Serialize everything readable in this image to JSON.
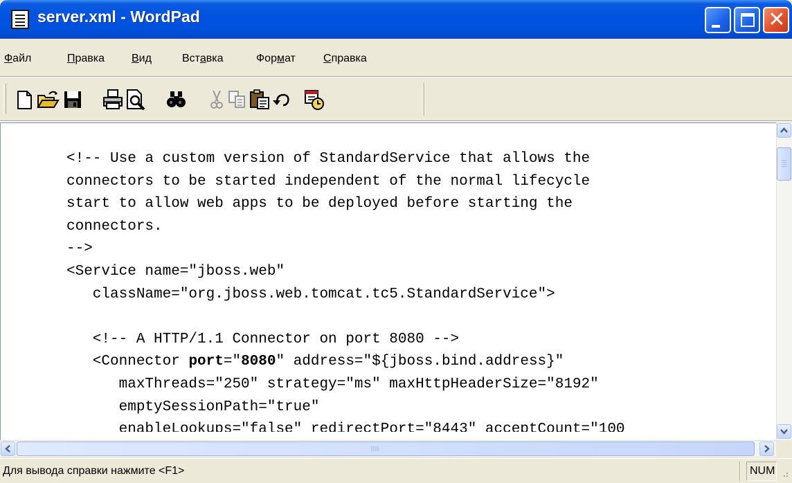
{
  "window": {
    "title": "server.xml - WordPad",
    "accent": "#0054e3",
    "close_color": "#e3512c"
  },
  "menu": {
    "items": [
      {
        "pre": "",
        "accel": "Ф",
        "post": "айл"
      },
      {
        "pre": "",
        "accel": "П",
        "post": "равка"
      },
      {
        "pre": "",
        "accel": "В",
        "post": "ид"
      },
      {
        "pre": "Вст",
        "accel": "а",
        "post": "вка"
      },
      {
        "pre": "Фор",
        "accel": "м",
        "post": "ат"
      },
      {
        "pre": "",
        "accel": "С",
        "post": "правка"
      }
    ]
  },
  "toolbar": {
    "buttons": [
      "new-icon",
      "open-icon",
      "save-icon",
      "print-icon",
      "print-preview-icon",
      "find-icon",
      "cut-icon",
      "copy-icon",
      "paste-icon",
      "undo-icon",
      "date-time-icon"
    ]
  },
  "document": {
    "lines": [
      "<!-- Use a custom version of StandardService that allows the",
      "connectors to be started independent of the normal lifecycle",
      "start to allow web apps to be deployed before starting the",
      "connectors.",
      "-->",
      "<Service name=\"jboss.web\"",
      "   className=\"org.jboss.web.tomcat.tc5.StandardService\">",
      "",
      "   <!-- A HTTP/1.1 Connector on port 8080 -->",
      "   <Connector ",
      "      maxThreads=\"250\" strategy=\"ms\" maxHttpHeaderSize=\"8192\"",
      "      emptySessionPath=\"true\"",
      "      enableLookups=\"false\" redirectPort=\"8443\" acceptCount=\"100"
    ],
    "connector_line": {
      "prefix": "   <Connector ",
      "bold_attr": "port",
      "eq": "=\"",
      "bold_val": "8080",
      "suffix": "\" address=\"${jboss.bind.address}\""
    }
  },
  "statusbar": {
    "help_text": "Для вывода справки нажмите <F1>",
    "num": "NUM"
  }
}
